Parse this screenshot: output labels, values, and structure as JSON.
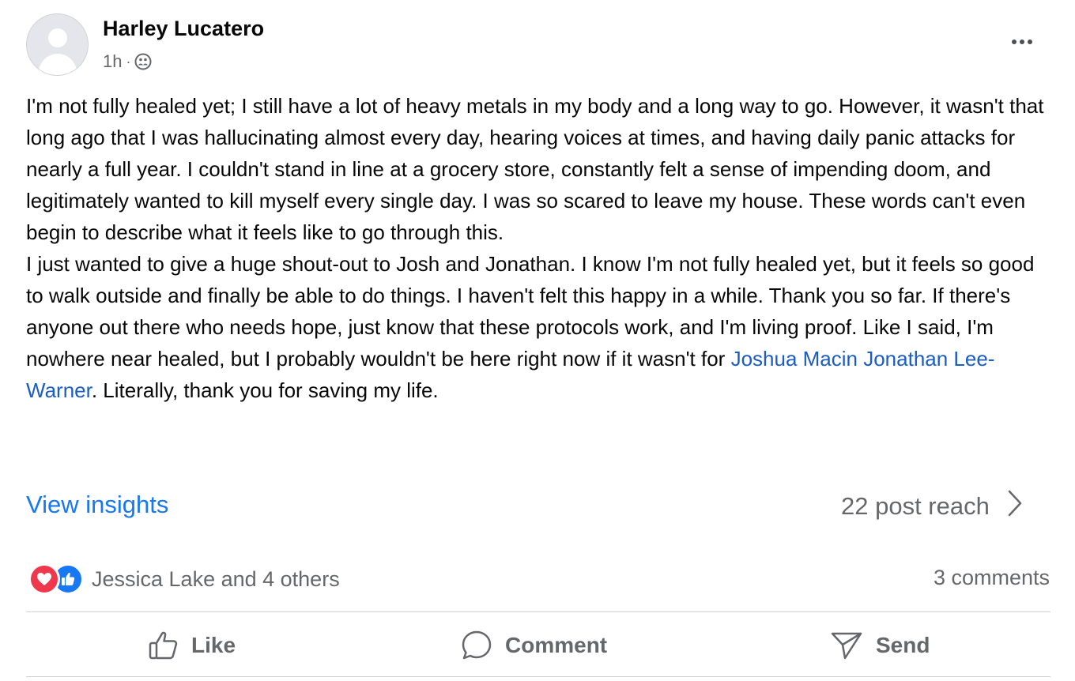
{
  "post": {
    "author": "Harley Lucatero",
    "time": "1h",
    "separator": "·",
    "audience_icon": "friends-icon",
    "more_icon": "more-horizontal-icon",
    "body": {
      "paragraph1": "I'm not fully healed yet; I still have a lot of heavy metals in my body and a long way to go. However, it wasn't that long ago that I was hallucinating almost every day, hearing voices at times, and having daily panic attacks for nearly a full year. I couldn't stand in line at a grocery store, constantly felt a sense of impending doom, and legitimately wanted to kill myself every single day. I was so scared to leave my house. These words can't even begin to describe what it feels like to go through this.",
      "paragraph2_before": "I just wanted to give a huge shout-out to Josh and Jonathan. I know I'm not fully healed yet, but it feels so good to walk outside and finally be able to do things. I haven't felt this happy in a while. Thank you so far. If there's anyone out there who needs hope, just know that these protocols work, and I'm living proof. Like I said, I'm nowhere near healed, but I probably wouldn't be here right now if it wasn't for ",
      "mentions": "Joshua Macin Jonathan Lee-Warner",
      "paragraph2_after": ". Literally, thank you for saving my life."
    }
  },
  "insights": {
    "link": "View insights",
    "reach": "22 post reach",
    "chevron_icon": "chevron-right-icon"
  },
  "reactions": {
    "icons": [
      "love-reaction-icon",
      "like-reaction-icon"
    ],
    "summary": "Jessica Lake and 4 others",
    "comments": "3 comments"
  },
  "actions": {
    "like": "Like",
    "comment": "Comment",
    "send": "Send"
  },
  "colors": {
    "link": "#1877f2",
    "mention": "#1b5cc6",
    "secondary_text": "#65676b",
    "love": "#f0384d",
    "like": "#1877f2"
  }
}
